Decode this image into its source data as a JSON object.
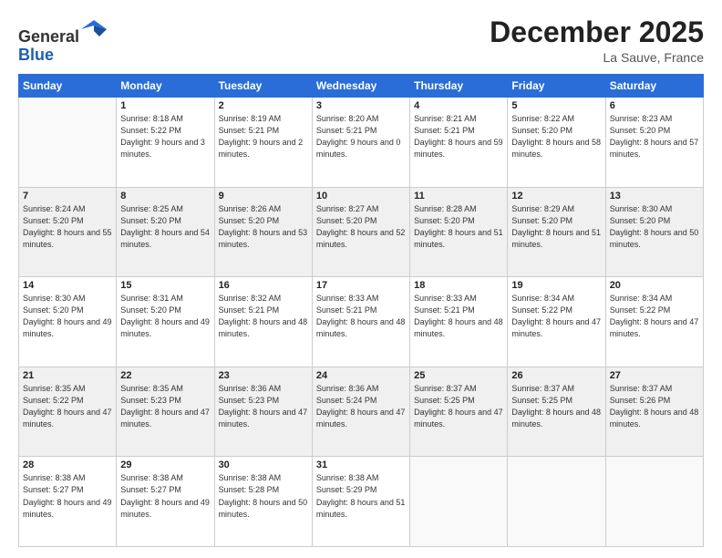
{
  "header": {
    "logo_line1": "General",
    "logo_line2": "Blue",
    "month": "December 2025",
    "location": "La Sauve, France"
  },
  "weekdays": [
    "Sunday",
    "Monday",
    "Tuesday",
    "Wednesday",
    "Thursday",
    "Friday",
    "Saturday"
  ],
  "weeks": [
    [
      {
        "day": "",
        "info": ""
      },
      {
        "day": "1",
        "info": "Sunrise: 8:18 AM\nSunset: 5:22 PM\nDaylight: 9 hours\nand 3 minutes."
      },
      {
        "day": "2",
        "info": "Sunrise: 8:19 AM\nSunset: 5:21 PM\nDaylight: 9 hours\nand 2 minutes."
      },
      {
        "day": "3",
        "info": "Sunrise: 8:20 AM\nSunset: 5:21 PM\nDaylight: 9 hours\nand 0 minutes."
      },
      {
        "day": "4",
        "info": "Sunrise: 8:21 AM\nSunset: 5:21 PM\nDaylight: 8 hours\nand 59 minutes."
      },
      {
        "day": "5",
        "info": "Sunrise: 8:22 AM\nSunset: 5:20 PM\nDaylight: 8 hours\nand 58 minutes."
      },
      {
        "day": "6",
        "info": "Sunrise: 8:23 AM\nSunset: 5:20 PM\nDaylight: 8 hours\nand 57 minutes."
      }
    ],
    [
      {
        "day": "7",
        "info": "Sunrise: 8:24 AM\nSunset: 5:20 PM\nDaylight: 8 hours\nand 55 minutes."
      },
      {
        "day": "8",
        "info": "Sunrise: 8:25 AM\nSunset: 5:20 PM\nDaylight: 8 hours\nand 54 minutes."
      },
      {
        "day": "9",
        "info": "Sunrise: 8:26 AM\nSunset: 5:20 PM\nDaylight: 8 hours\nand 53 minutes."
      },
      {
        "day": "10",
        "info": "Sunrise: 8:27 AM\nSunset: 5:20 PM\nDaylight: 8 hours\nand 52 minutes."
      },
      {
        "day": "11",
        "info": "Sunrise: 8:28 AM\nSunset: 5:20 PM\nDaylight: 8 hours\nand 51 minutes."
      },
      {
        "day": "12",
        "info": "Sunrise: 8:29 AM\nSunset: 5:20 PM\nDaylight: 8 hours\nand 51 minutes."
      },
      {
        "day": "13",
        "info": "Sunrise: 8:30 AM\nSunset: 5:20 PM\nDaylight: 8 hours\nand 50 minutes."
      }
    ],
    [
      {
        "day": "14",
        "info": "Sunrise: 8:30 AM\nSunset: 5:20 PM\nDaylight: 8 hours\nand 49 minutes."
      },
      {
        "day": "15",
        "info": "Sunrise: 8:31 AM\nSunset: 5:20 PM\nDaylight: 8 hours\nand 49 minutes."
      },
      {
        "day": "16",
        "info": "Sunrise: 8:32 AM\nSunset: 5:21 PM\nDaylight: 8 hours\nand 48 minutes."
      },
      {
        "day": "17",
        "info": "Sunrise: 8:33 AM\nSunset: 5:21 PM\nDaylight: 8 hours\nand 48 minutes."
      },
      {
        "day": "18",
        "info": "Sunrise: 8:33 AM\nSunset: 5:21 PM\nDaylight: 8 hours\nand 48 minutes."
      },
      {
        "day": "19",
        "info": "Sunrise: 8:34 AM\nSunset: 5:22 PM\nDaylight: 8 hours\nand 47 minutes."
      },
      {
        "day": "20",
        "info": "Sunrise: 8:34 AM\nSunset: 5:22 PM\nDaylight: 8 hours\nand 47 minutes."
      }
    ],
    [
      {
        "day": "21",
        "info": "Sunrise: 8:35 AM\nSunset: 5:22 PM\nDaylight: 8 hours\nand 47 minutes."
      },
      {
        "day": "22",
        "info": "Sunrise: 8:35 AM\nSunset: 5:23 PM\nDaylight: 8 hours\nand 47 minutes."
      },
      {
        "day": "23",
        "info": "Sunrise: 8:36 AM\nSunset: 5:23 PM\nDaylight: 8 hours\nand 47 minutes."
      },
      {
        "day": "24",
        "info": "Sunrise: 8:36 AM\nSunset: 5:24 PM\nDaylight: 8 hours\nand 47 minutes."
      },
      {
        "day": "25",
        "info": "Sunrise: 8:37 AM\nSunset: 5:25 PM\nDaylight: 8 hours\nand 47 minutes."
      },
      {
        "day": "26",
        "info": "Sunrise: 8:37 AM\nSunset: 5:25 PM\nDaylight: 8 hours\nand 48 minutes."
      },
      {
        "day": "27",
        "info": "Sunrise: 8:37 AM\nSunset: 5:26 PM\nDaylight: 8 hours\nand 48 minutes."
      }
    ],
    [
      {
        "day": "28",
        "info": "Sunrise: 8:38 AM\nSunset: 5:27 PM\nDaylight: 8 hours\nand 49 minutes."
      },
      {
        "day": "29",
        "info": "Sunrise: 8:38 AM\nSunset: 5:27 PM\nDaylight: 8 hours\nand 49 minutes."
      },
      {
        "day": "30",
        "info": "Sunrise: 8:38 AM\nSunset: 5:28 PM\nDaylight: 8 hours\nand 50 minutes."
      },
      {
        "day": "31",
        "info": "Sunrise: 8:38 AM\nSunset: 5:29 PM\nDaylight: 8 hours\nand 51 minutes."
      },
      {
        "day": "",
        "info": ""
      },
      {
        "day": "",
        "info": ""
      },
      {
        "day": "",
        "info": ""
      }
    ]
  ]
}
